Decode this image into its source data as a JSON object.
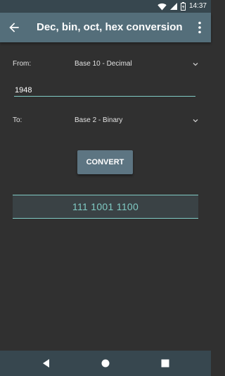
{
  "status_bar": {
    "time": "14:37",
    "icons": [
      "wifi-icon",
      "signal-icon",
      "battery-icon"
    ]
  },
  "app_bar": {
    "title": "Dec, bin, oct, hex conversion",
    "back_icon": "arrow-back-icon",
    "menu_icon": "more-vert-icon"
  },
  "form": {
    "from_label": "From:",
    "from_value": "Base 10 - Decimal",
    "input_value": "1948",
    "to_label": "To:",
    "to_value": "Base 2 - Binary",
    "convert_label": "CONVERT"
  },
  "result": {
    "value": "111 1001 1100"
  },
  "nav_bar": {
    "icons": [
      "back-triangle-icon",
      "home-circle-icon",
      "recents-square-icon"
    ]
  },
  "colors": {
    "app_bar": "#546e7a",
    "status_bar": "#37474f",
    "background": "#303030",
    "accent": "#80cbc4",
    "button": "#5d7582"
  }
}
